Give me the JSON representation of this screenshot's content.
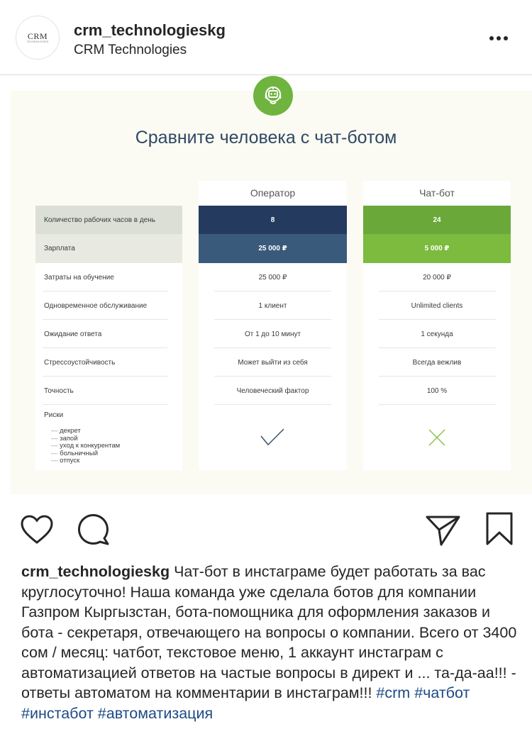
{
  "header": {
    "avatar_logo": "CRM",
    "avatar_logo_sub": "TECHNOLOGIES",
    "username": "crm_technologieskg",
    "display_name": "CRM Technologies"
  },
  "slide": {
    "title": "Сравните человека с чат-ботом",
    "columns": {
      "operator": "Оператор",
      "bot": "Чат-бот"
    },
    "rows": [
      {
        "label": "Количество рабочих часов в день",
        "operator": "8",
        "bot": "24"
      },
      {
        "label": "Зарплата",
        "operator": "25 000 ₽",
        "bot": "5 000 ₽"
      },
      {
        "label": "Затраты на обучение",
        "operator": "25 000 ₽",
        "bot": "20 000 ₽"
      },
      {
        "label": "Одновременное обслуживание",
        "operator": "1 клиент",
        "bot": "Unlimited clients"
      },
      {
        "label": "Ожидание ответа",
        "operator": "От 1 до 10 минут",
        "bot": "1 секунда"
      },
      {
        "label": "Стрессоустойчивость",
        "operator": "Может выйти из себя",
        "bot": "Всегда вежлив"
      },
      {
        "label": "Точность",
        "operator": "Человеческий фактор",
        "bot": "100 %"
      }
    ],
    "risks": {
      "label": "Риски",
      "items": [
        "декрет",
        "запой",
        "уход к конкурентам",
        "больничный",
        "отпуск"
      ],
      "operator_icon": "check-icon",
      "bot_icon": "cross-icon"
    },
    "colors": {
      "operator_dark": "#243a5e",
      "operator_mid": "#3a5a7c",
      "bot_dark": "#6aa83a",
      "bot_light": "#7cbb3e",
      "label_dark": "#dcdfd5",
      "label_light": "#e8eae1",
      "title": "#2f4863"
    }
  },
  "actions": {
    "like_icon": "heart-icon",
    "comment_icon": "comment-icon",
    "share_icon": "paper-plane-icon",
    "save_icon": "bookmark-icon"
  },
  "caption": {
    "username": "crm_technologieskg",
    "text": " Чат-бот в инстаграме будет работать за вас круглосуточно!  Наша команда уже сделала ботов для компании Газпром Кыргызстан, бота-помощника для оформления заказов и бота - секретаря, отвечающего на вопросы о компании. Всего от 3400 сом / месяц: чатбот, текстовое меню, 1 аккаунт инстаграм с автоматизацией ответов на частые вопросы в директ и ... та-да-аа!!! - ответы автоматом на комментарии в инстаграм!!! ",
    "tags": [
      "#crm",
      "#чатбот",
      "#инстабот",
      "#автоматизация"
    ]
  }
}
